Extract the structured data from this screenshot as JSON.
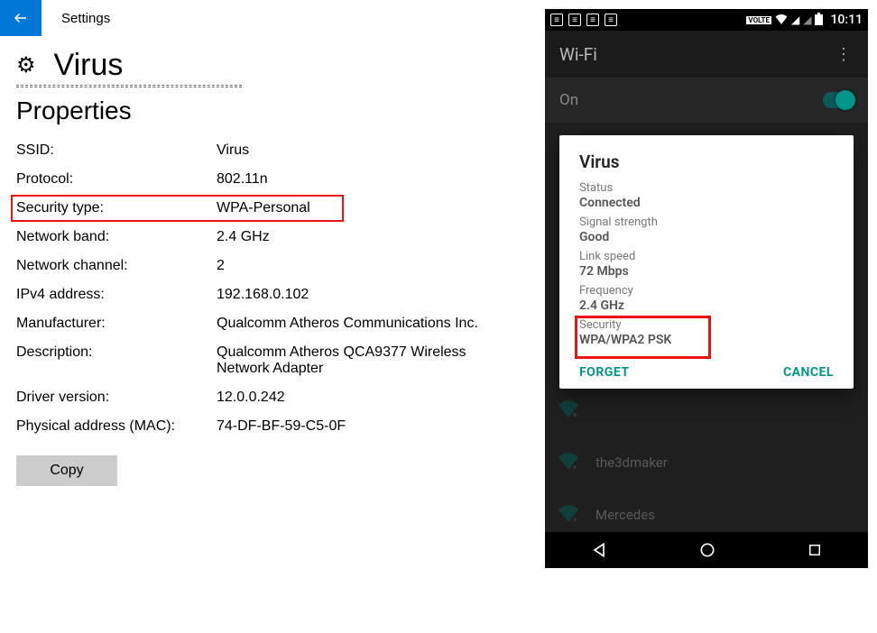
{
  "windows": {
    "settings_label": "Settings",
    "title": "Virus",
    "subtitle": "Properties",
    "rows": [
      {
        "key": "SSID:",
        "value": "Virus"
      },
      {
        "key": "Protocol:",
        "value": "802.11n"
      },
      {
        "key": "Security type:",
        "value": "WPA-Personal",
        "highlight": true
      },
      {
        "key": "Network band:",
        "value": "2.4 GHz"
      },
      {
        "key": "Network channel:",
        "value": "2"
      },
      {
        "key": "IPv4 address:",
        "value": "192.168.0.102"
      },
      {
        "key": "Manufacturer:",
        "value": "Qualcomm Atheros Communications Inc."
      },
      {
        "key": "Description:",
        "value": "Qualcomm Atheros QCA9377 Wireless Network Adapter"
      },
      {
        "key": "Driver version:",
        "value": "12.0.0.242"
      },
      {
        "key": "Physical address (MAC):",
        "value": "74-DF-BF-59-C5-0F"
      }
    ],
    "copy_label": "Copy"
  },
  "android": {
    "clock": "10:11",
    "volte": "VOLTE",
    "header_title": "Wi-Fi",
    "toggle_label": "On",
    "dialog": {
      "title": "Virus",
      "rows": [
        {
          "key": "Status",
          "value": "Connected"
        },
        {
          "key": "Signal strength",
          "value": "Good"
        },
        {
          "key": "Link speed",
          "value": "72 Mbps"
        },
        {
          "key": "Frequency",
          "value": "2.4 GHz"
        }
      ],
      "security_key": "Security",
      "security_value": "WPA/WPA2 PSK",
      "forget": "FORGET",
      "cancel": "CANCEL"
    },
    "bg_networks": [
      "",
      "",
      "",
      "",
      "",
      "",
      "the3dmaker",
      "Mercedes"
    ]
  }
}
